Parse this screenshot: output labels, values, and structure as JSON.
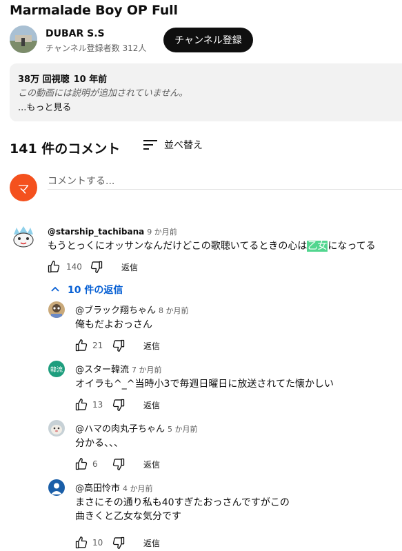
{
  "video": {
    "title": "Marmalade Boy OP Full",
    "channel_name": "DUBAR S.S",
    "subscribers": "チャンネル登録者数 312人",
    "subscribe_label": "チャンネル登録",
    "views": "38万 回視聴",
    "uploaded": "10 年前",
    "description": "この動画には説明が追加されていません。",
    "more_label": "...もっと見る"
  },
  "comments_section": {
    "count_label": "141 件のコメント",
    "sort_label": "並べ替え",
    "add_placeholder": "コメントする...",
    "my_avatar_letter": "マ"
  },
  "top_comment": {
    "author": "@starship_tachibana",
    "time": "9 か月前",
    "text_before": "もうとっくにオッサンなんだけどこの歌聴いてるときの心は",
    "text_highlight": "乙女",
    "text_after": "になってる",
    "likes": "140",
    "reply_label": "返信",
    "replies_toggle": "10 件の返信"
  },
  "replies": [
    {
      "author": "@ブラック翔ちゃん",
      "time": "8 か月前",
      "lines": [
        "俺もだよおっさん"
      ],
      "likes": "21",
      "reply_label": "返信"
    },
    {
      "author": "@スター韓流",
      "time": "7 か月前",
      "lines": [
        "オイラも^_^当時小3で毎週日曜日に放送されてた懐かしい"
      ],
      "likes": "13",
      "reply_label": "返信",
      "avatar_text": "韓流"
    },
    {
      "author": "@ハマの肉丸子ちゃん",
      "time": "5 か月前",
      "lines": [
        "分かる、、、"
      ],
      "likes": "6",
      "reply_label": "返信"
    },
    {
      "author": "@高田怜市",
      "time": "4 か月前",
      "lines": [
        "まさにその通り私も40すぎたおっさんですがこの",
        "曲きくと乙女な気分です"
      ],
      "likes": "10",
      "reply_label": "返信"
    }
  ],
  "colors": {
    "accent_link": "#065fd4",
    "subscribe_bg": "#0f0f0f",
    "my_avatar": "#f4511e",
    "highlight": "#52d68f"
  }
}
